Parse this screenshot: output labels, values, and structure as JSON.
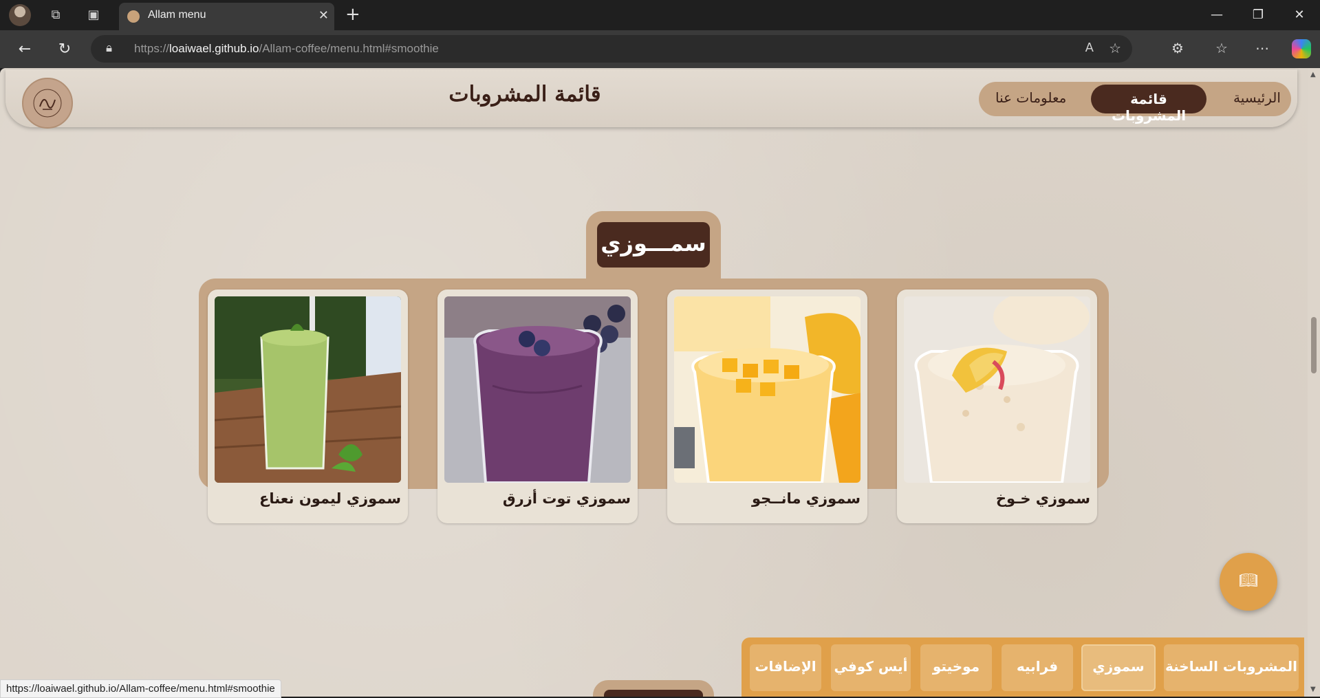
{
  "browser": {
    "tab_title": "Allam menu",
    "url_prefix": "https://",
    "url_domain": "loaiwael.github.io",
    "url_path": "/Allam-coffee/menu.html#smoothie",
    "status_url": "https://loaiwael.github.io/Allam-coffee/menu.html#smoothie"
  },
  "header": {
    "title": "قائمة المشروبات",
    "nav": {
      "home": "الرئيسية",
      "menu": "قائمة المشروبات",
      "about": "معلومات عنا"
    }
  },
  "section": {
    "title": "سمـــوزي",
    "items": [
      {
        "name": "سموزي خـوخ",
        "image": "peach-smoothie"
      },
      {
        "name": "سموزي مانــجو",
        "image": "mango-smoothie"
      },
      {
        "name": "سموزي توت أزرق",
        "image": "blueberry-smoothie"
      },
      {
        "name": "سموزي ليمون نعناع",
        "image": "lemon-mint-smoothie"
      }
    ]
  },
  "categories": {
    "hot": "المشروبات الساخنة",
    "smoothie": "سموزي",
    "frappe": "فرابيه",
    "mojito": "موخيتو",
    "iced": "أيس كوفي",
    "extras": "الإضافات"
  },
  "colors": {
    "accent": "#e0a04a",
    "brown": "#4a2a1f",
    "tan": "#c5a585",
    "background": "#ddd5cb"
  }
}
